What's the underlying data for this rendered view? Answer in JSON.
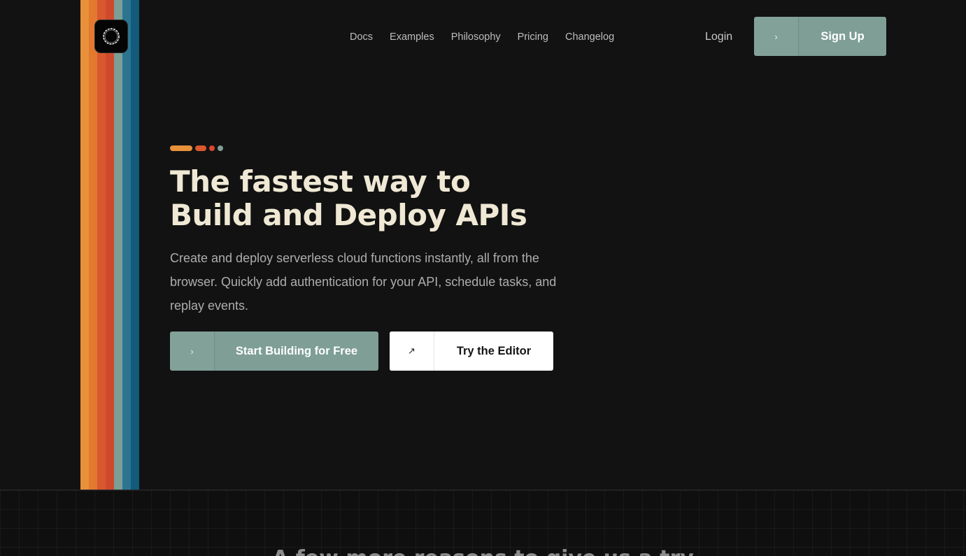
{
  "brand": {
    "logo_icon": "ring-logo-icon",
    "stripe_colors": [
      "#E8913A",
      "#E3782F",
      "#D9582E",
      "#CF4A2D",
      "#7C9E96",
      "#2C7591",
      "#125B7A"
    ]
  },
  "nav": {
    "items": [
      {
        "label": "Docs"
      },
      {
        "label": "Examples"
      },
      {
        "label": "Philosophy"
      },
      {
        "label": "Pricing"
      },
      {
        "label": "Changelog"
      }
    ],
    "login_label": "Login",
    "signup": {
      "label": "Sign Up",
      "icon": "chevron-right-icon"
    }
  },
  "hero": {
    "title_line1": "The fastest way to",
    "title_line2": "Build and Deploy APIs",
    "subtitle": "Create and deploy serverless cloud functions instantly, all from the browser. Quickly add authentication for your API, schedule tasks, and replay events.",
    "primary_cta": {
      "label": "Start Building for Free",
      "icon": "chevron-right-icon"
    },
    "secondary_cta": {
      "label": "Try the Editor",
      "icon": "arrow-up-right-icon"
    }
  },
  "lower": {
    "heading": "A few more reasons to give us a try"
  },
  "colors": {
    "background": "#121212",
    "accent_sage": "#7E9E96",
    "title_cream": "#EFE8D4"
  }
}
